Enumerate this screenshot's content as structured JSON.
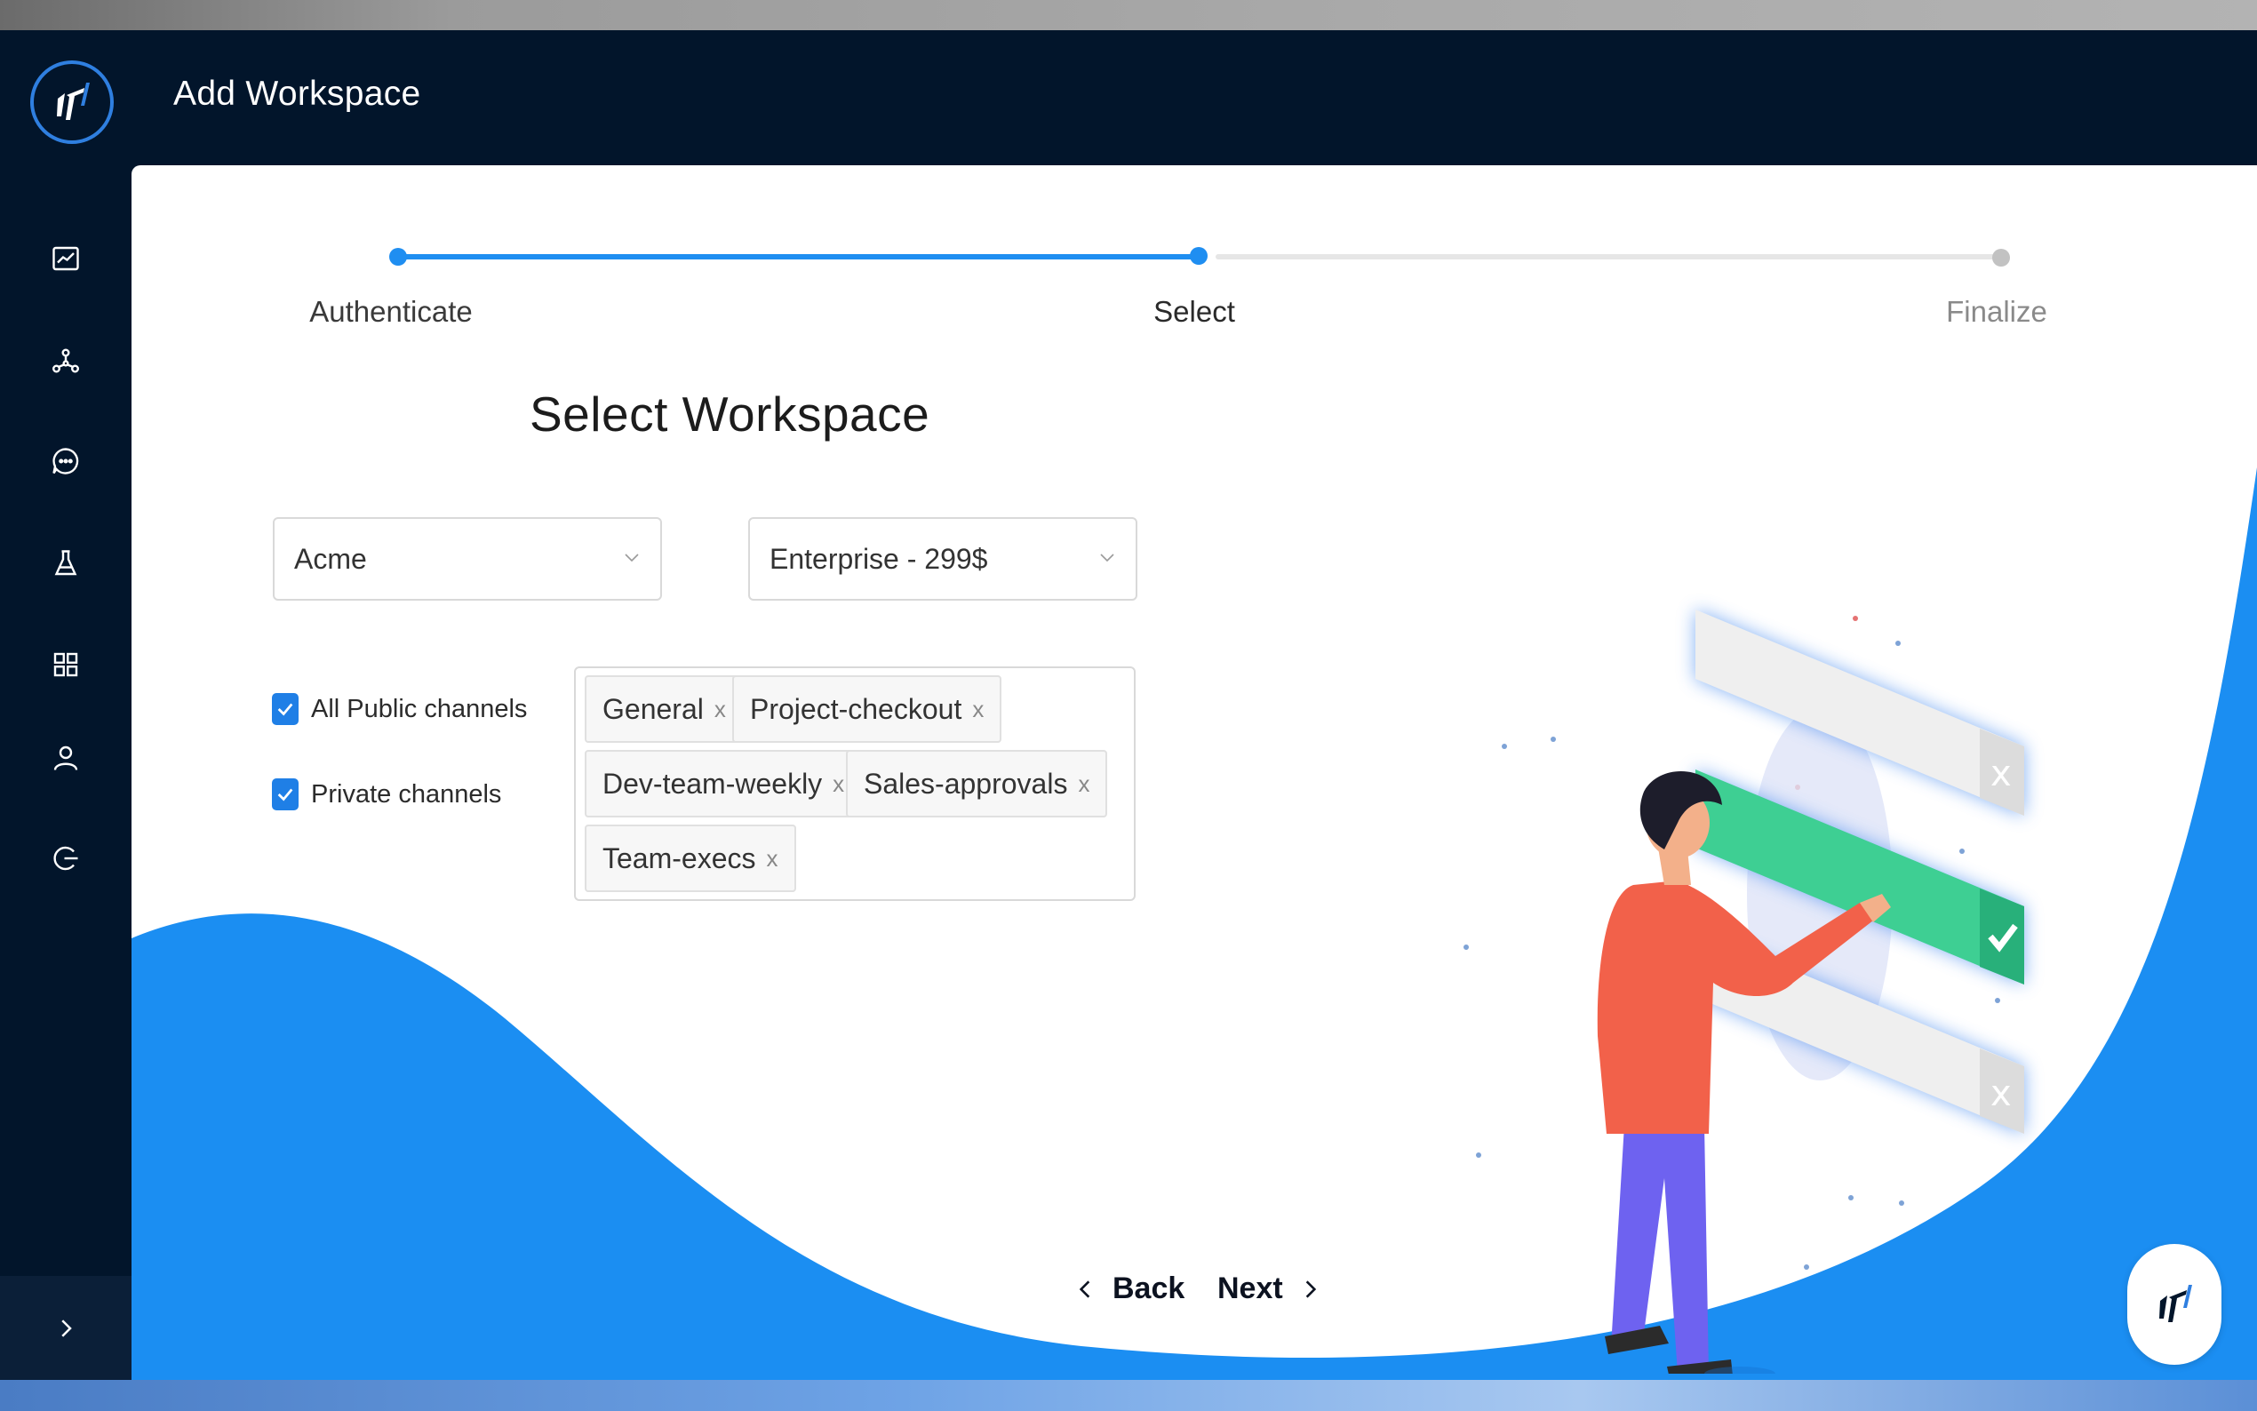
{
  "app": {
    "header_title": "Add Workspace",
    "accent_color": "#1f8ef1",
    "sidebar_bg": "#02152b"
  },
  "sidebar": {
    "items": [
      {
        "icon": "chart-line-icon"
      },
      {
        "icon": "network-icon"
      },
      {
        "icon": "chat-bubble-icon"
      },
      {
        "icon": "flask-icon"
      },
      {
        "icon": "grid-icon"
      },
      {
        "icon": "user-icon"
      },
      {
        "icon": "logout-icon"
      }
    ],
    "expand_icon": "chevron-right-icon"
  },
  "stepper": {
    "steps": [
      {
        "label": "Authenticate",
        "state": "completed"
      },
      {
        "label": "Select",
        "state": "active"
      },
      {
        "label": "Finalize",
        "state": "pending"
      }
    ]
  },
  "form": {
    "title": "Select Workspace",
    "workspace_select": {
      "value": "Acme"
    },
    "plan_select": {
      "value": "Enterprise - 299$"
    },
    "checkboxes": [
      {
        "label": "All Public channels",
        "checked": true
      },
      {
        "label": "Private channels",
        "checked": true
      }
    ],
    "channel_tags": [
      "General",
      "Project-checkout",
      "Dev-team-weekly",
      "Sales-approvals",
      "Team-execs"
    ],
    "tag_remove_symbol": "x"
  },
  "footer_nav": {
    "back_label": "Back",
    "next_label": "Next"
  }
}
